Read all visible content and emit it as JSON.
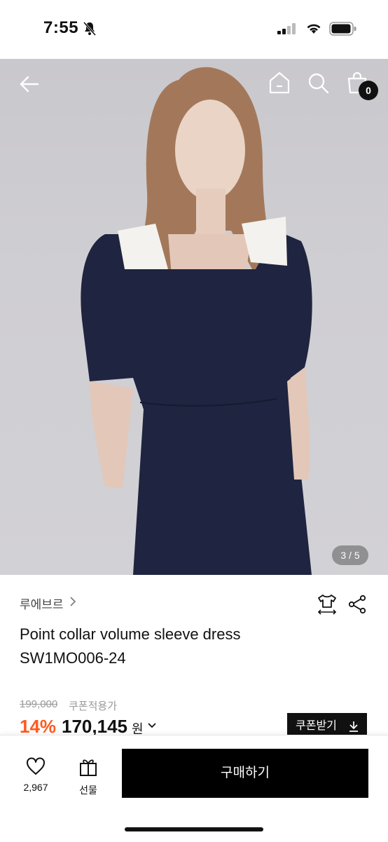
{
  "status_bar": {
    "time": "7:55"
  },
  "header": {
    "cart_count": "0"
  },
  "gallery": {
    "indicator": "3 / 5"
  },
  "product": {
    "brand": "루에브르",
    "name_line1": "Point collar volume sleeve dress",
    "name_line2": "SW1MO006-24",
    "original_price": "199,000",
    "coupon_label": "쿠폰적용가",
    "discount": "14%",
    "price": "170,145",
    "currency": "원"
  },
  "coupon_button": {
    "label": "쿠폰받기"
  },
  "bottom_bar": {
    "like_count": "2,967",
    "gift_label": "선물",
    "buy_label": "구매하기"
  },
  "colors": {
    "discount": "#ff5a1f",
    "button": "#000000"
  }
}
